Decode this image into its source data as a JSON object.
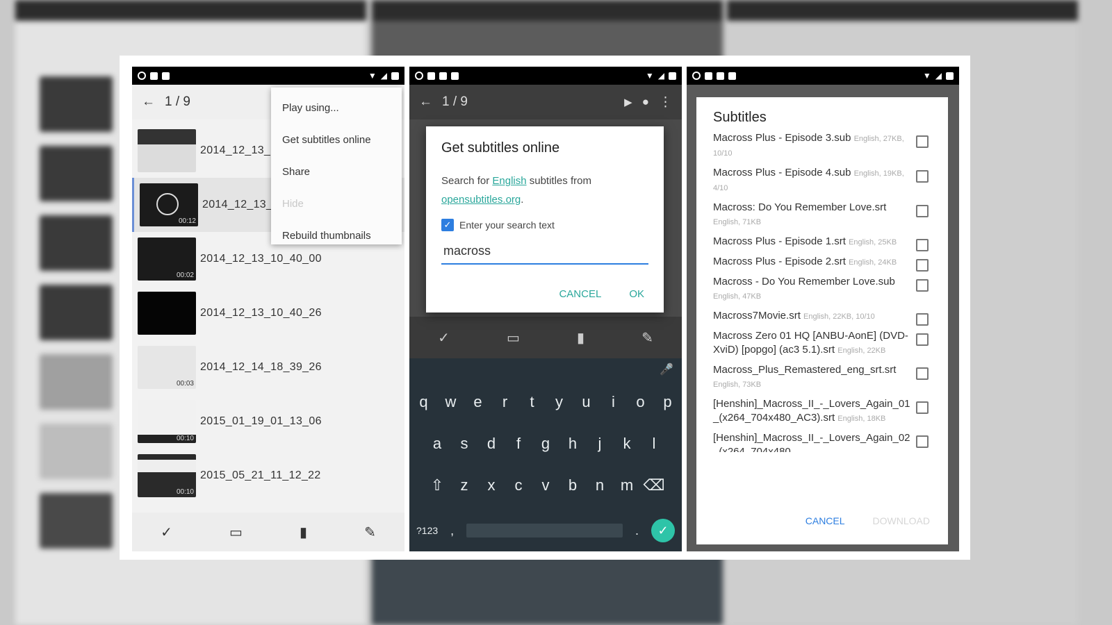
{
  "phone1": {
    "counter": "1 / 9",
    "menu": [
      "Play using...",
      "Get subtitles online",
      "Share",
      "Hide",
      "Rebuild thumbnails"
    ],
    "files": [
      "2014_12_13_",
      "2014_12_13_",
      "2014_12_13_10_40_00",
      "2014_12_13_10_40_26",
      "2014_12_14_18_39_26",
      "2015_01_19_01_13_06",
      "2015_05_21_11_12_22"
    ],
    "durations": [
      "",
      "00:12",
      "00:02",
      "",
      "00:03",
      "00:10",
      "00:10"
    ]
  },
  "phone2": {
    "counter": "1 / 9",
    "dialog": {
      "title": "Get subtitles online",
      "text_before": "Search for ",
      "language": "English",
      "text_mid": " subtitles from",
      "site": "opensubtitles.org",
      "text_after": ".",
      "checkbox_label": "Enter your search text",
      "query": "macross",
      "cancel": "CANCEL",
      "ok": "OK"
    },
    "keyboard": {
      "row1": [
        "q",
        "w",
        "e",
        "r",
        "t",
        "y",
        "u",
        "i",
        "o",
        "p"
      ],
      "row2": [
        "a",
        "s",
        "d",
        "f",
        "g",
        "h",
        "j",
        "k",
        "l"
      ],
      "row3": [
        "z",
        "x",
        "c",
        "v",
        "b",
        "n",
        "m"
      ],
      "symbols": "?123",
      "comma": ",",
      "period": "."
    }
  },
  "phone3": {
    "title": "Subtitles",
    "items": [
      {
        "name": "Macross Plus - Episode 3.sub",
        "meta": "English, 27KB, 10/10"
      },
      {
        "name": "Macross Plus - Episode 4.sub",
        "meta": "English, 19KB, 4/10"
      },
      {
        "name": "Macross: Do You Remember Love.srt",
        "meta": "English, 71KB"
      },
      {
        "name": "Macross Plus - Episode 1.srt",
        "meta": "English, 25KB"
      },
      {
        "name": "Macross Plus - Episode 2.srt",
        "meta": "English, 24KB"
      },
      {
        "name": "Macross - Do You Remember Love.sub",
        "meta": "English, 47KB"
      },
      {
        "name": "Macross7Movie.srt",
        "meta": "English, 22KB, 10/10"
      },
      {
        "name": "Macross Zero 01 HQ [ANBU-AonE] (DVD-XviD) [popgo] (ac3 5.1).srt",
        "meta": "English, 22KB"
      },
      {
        "name": "Macross_Plus_Remastered_eng_srt.srt",
        "meta": "English, 73KB"
      },
      {
        "name": "[Henshin]_Macross_II_-_Lovers_Again_01_(x264_704x480_AC3).srt",
        "meta": "English, 18KB"
      },
      {
        "name": "[Henshin]_Macross_II_-_Lovers_Again_02_(x264_704x480",
        "meta": ""
      }
    ],
    "cancel": "CANCEL",
    "download": "DOWNLOAD"
  },
  "colors": {
    "accent": "#2aa79b",
    "checkbox": "#2d7ee0",
    "keyboard": "#27323a"
  }
}
